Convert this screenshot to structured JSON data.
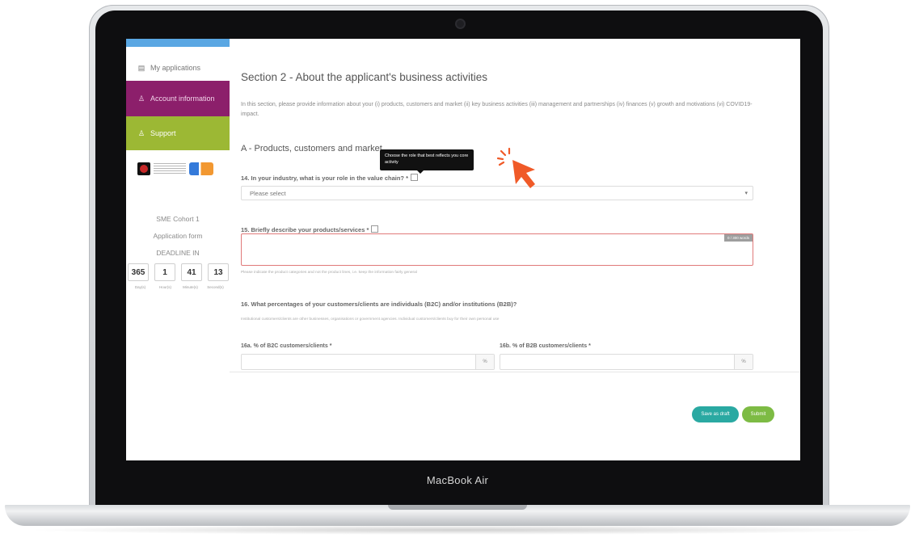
{
  "sidebar": {
    "items": [
      {
        "label": "My applications",
        "icon": "document-icon"
      },
      {
        "label": "Account information",
        "icon": "user-icon"
      },
      {
        "label": "Support",
        "icon": "user-icon"
      }
    ],
    "cohort": "SME Cohort 1",
    "application_form": "Application form",
    "deadline_label": "DEADLINE IN",
    "countdown": [
      {
        "value": "365",
        "unit": "Day(s)"
      },
      {
        "value": "1",
        "unit": "Hour(s)"
      },
      {
        "value": "41",
        "unit": "Minute(s)"
      },
      {
        "value": "13",
        "unit": "Second(s)"
      }
    ]
  },
  "main": {
    "section_title": "Section 2 - About the applicant's business activities",
    "section_description": "In this section, please provide information about your (i) products, customers and market (ii) key business activities (iii) management and partnerships (iv) finances (v) growth and motivations (vi) COVID19-impact.",
    "subheading": "A - Products, customers and market",
    "tooltip": "Choose the role that best reflects you core activity",
    "q14": {
      "label": "14. In your industry, what is your role in the value chain? *",
      "placeholder": "Please select"
    },
    "q15": {
      "label": "15. Briefly describe your products/services *",
      "word_count": "0 / 300 words",
      "hint": "Please indicate the product categories and not the product lines, i.e. keep the information fairly general"
    },
    "q16": {
      "label": "16. What percentages of your customers/clients are individuals (B2C) and/or institutions (B2B)?",
      "hint": "Institutional customers/clients are other businesses, organisations or government agencies. Individual customers/clients buy for their own personal use"
    },
    "q16a": {
      "label": "16a. % of B2C customers/clients *",
      "unit": "%"
    },
    "q16b": {
      "label": "16b. % of B2B customers/clients *",
      "unit": "%"
    }
  },
  "actions": {
    "save_draft": "Save as draft",
    "submit": "Submit"
  },
  "device": {
    "brand": "MacBook Air"
  },
  "colors": {
    "account_bg": "#8c1f6b",
    "support_bg": "#9cb834",
    "draft_btn": "#2aa9a2",
    "submit_btn": "#7dbb44",
    "cursor": "#f05a28"
  }
}
